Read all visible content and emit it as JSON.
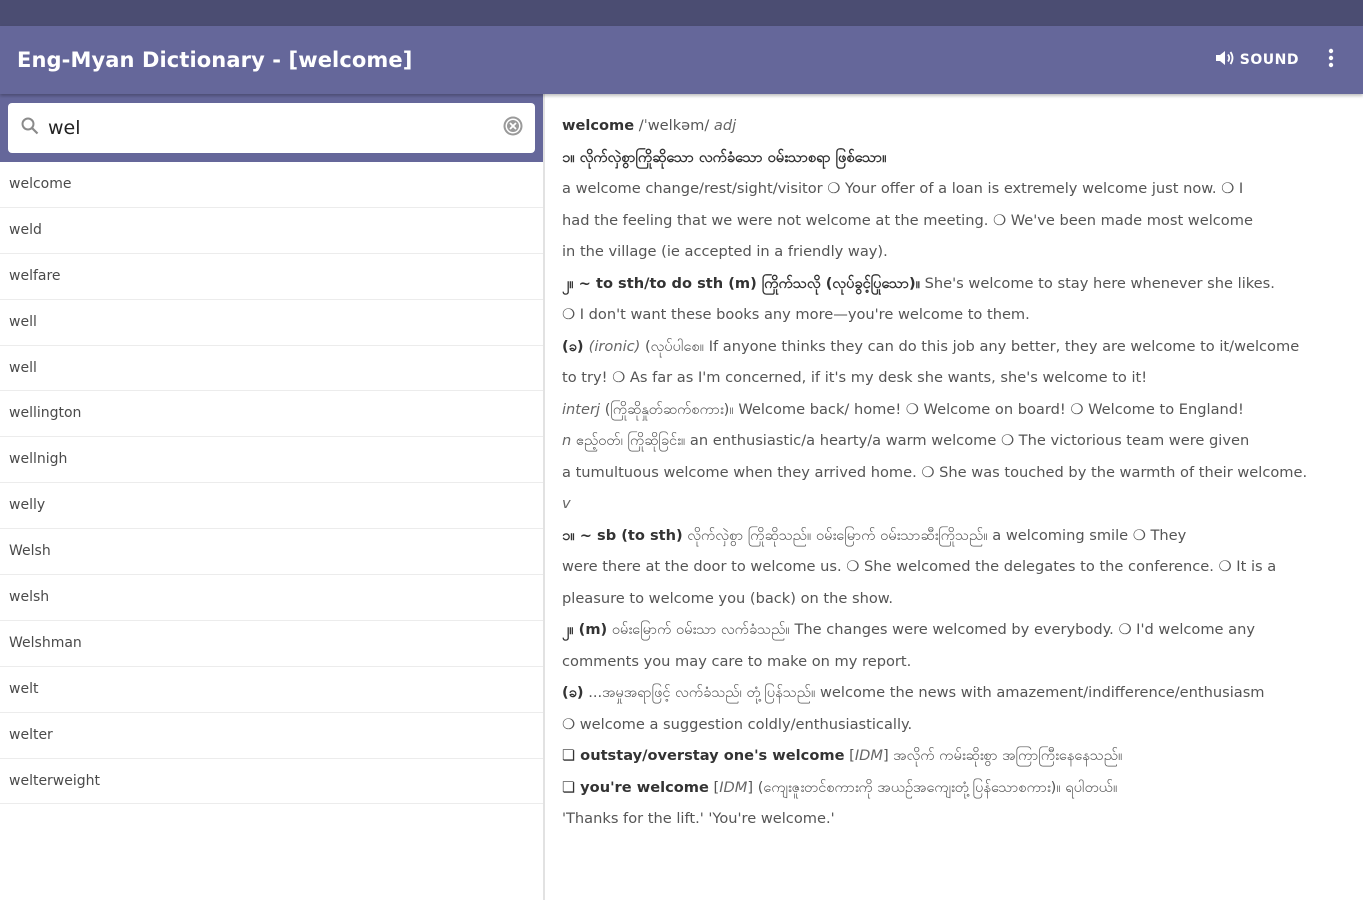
{
  "app": {
    "title": "Eng-Myan Dictionary - [welcome]",
    "sound_label": "SOUND"
  },
  "search": {
    "value": "wel"
  },
  "word_list": [
    "welcome",
    "weld",
    "welfare",
    "well",
    "well",
    "wellington",
    "wellnigh",
    "welly",
    "Welsh",
    "welsh",
    "Welshman",
    "welt",
    "welter",
    "welterweight"
  ],
  "definition": {
    "lines": [
      [
        {
          "t": "welcome",
          "s": "b"
        },
        {
          "t": " /ˈwelkəm/ ",
          "s": ""
        },
        {
          "t": "adj",
          "s": "i"
        }
      ],
      [
        {
          "t": "၁။ လိုက်လှဲစွာကြိုဆိုသော လက်ခံသော ဝမ်းသာစရာ ဖြစ်သော။",
          "s": "b"
        }
      ],
      [
        {
          "t": "a welcome change/rest/sight/visitor ❍ Your offer of a loan is extremely welcome just now. ❍ I",
          "s": ""
        }
      ],
      [
        {
          "t": "had the feeling that we were not welcome at the meeting. ❍ We've been made most welcome",
          "s": ""
        }
      ],
      [
        {
          "t": "in the village (ie accepted in a friendly way).",
          "s": ""
        }
      ],
      [
        {
          "t": "၂။ ~ to sth/to do sth (m) ကြိုက်သလို (လုပ်ခွင့်ပြုသော)။",
          "s": "b"
        },
        {
          "t": " She's welcome to stay here whenever she likes.",
          "s": ""
        }
      ],
      [
        {
          "t": "❍ I don't want these books any more—you're welcome to them.",
          "s": ""
        }
      ],
      [
        {
          "t": "(ခ) ",
          "s": "b"
        },
        {
          "t": "(ironic)",
          "s": "i"
        },
        {
          "t": " (လုပ်ပါစေ။ If anyone thinks they can do this job any better, they are welcome to it/welcome",
          "s": ""
        }
      ],
      [
        {
          "t": "to try! ❍ As far as I'm concerned, if it's my desk she wants, she's welcome to it!",
          "s": ""
        }
      ],
      [
        {
          "t": "interj",
          "s": "i"
        },
        {
          "t": " (ကြိုဆိုနှုတ်ဆက်စကား)။ Welcome back/ home! ❍ Welcome on board! ❍ Welcome to England!",
          "s": ""
        }
      ],
      [
        {
          "t": "n",
          "s": "i"
        },
        {
          "t": " ဧည့်ဝတ်၊ ကြိုဆိုခြင်း။ an enthusiastic/a hearty/a warm welcome ❍ The victorious team were given",
          "s": ""
        }
      ],
      [
        {
          "t": "a tumultuous welcome when they arrived home. ❍ She was touched by the warmth of their welcome.",
          "s": ""
        }
      ],
      [
        {
          "t": "v",
          "s": "i"
        }
      ],
      [
        {
          "t": "၁။ ~ sb (to sth)",
          "s": "b"
        },
        {
          "t": " လိုက်လှဲစွာ ကြိုဆိုသည်။ ဝမ်းမြောက် ဝမ်းသာဆီးကြိုသည်။ a welcoming smile ❍ They",
          "s": ""
        }
      ],
      [
        {
          "t": "were there at the door to welcome us. ❍ She welcomed the delegates to the conference. ❍ It is a",
          "s": ""
        }
      ],
      [
        {
          "t": "pleasure to welcome you (back) on the show.",
          "s": ""
        }
      ],
      [
        {
          "t": "၂။ (m)",
          "s": "b"
        },
        {
          "t": " ဝမ်းမြောက် ဝမ်းသာ လက်ခံသည်။ The changes were welcomed by everybody. ❍ I'd welcome any",
          "s": ""
        }
      ],
      [
        {
          "t": "comments you may care to make on my report.",
          "s": ""
        }
      ],
      [
        {
          "t": "(ခ)",
          "s": "b"
        },
        {
          "t": " ...အမှုအရာဖြင့် လက်ခံသည်၊ တုံ့ပြန်သည်။ welcome the news with amazement/indifference/enthusiasm",
          "s": ""
        }
      ],
      [
        {
          "t": "❍ welcome a suggestion coldly/enthusiastically.",
          "s": ""
        }
      ],
      [
        {
          "t": "❏ outstay/overstay one's welcome",
          "s": "b"
        },
        {
          "t": " [",
          "s": ""
        },
        {
          "t": "IDM",
          "s": "i"
        },
        {
          "t": "] အလိုက် ကမ်းဆိုးစွာ အကြာကြီးနေနေသည်။",
          "s": ""
        }
      ],
      [
        {
          "t": "❏ you're welcome",
          "s": "b"
        },
        {
          "t": " [",
          "s": ""
        },
        {
          "t": "IDM",
          "s": "i"
        },
        {
          "t": "] (ကျေးဇူးတင်စကားကို အယဉ်အကျေးတုံ့ပြန်သောစကား)။ ရပါတယ်။",
          "s": ""
        }
      ],
      [
        {
          "t": "'Thanks for the lift.' 'You're welcome.'",
          "s": ""
        }
      ]
    ]
  },
  "colors": {
    "status_bar": "#4b4d72",
    "app_bar": "#65679a"
  }
}
